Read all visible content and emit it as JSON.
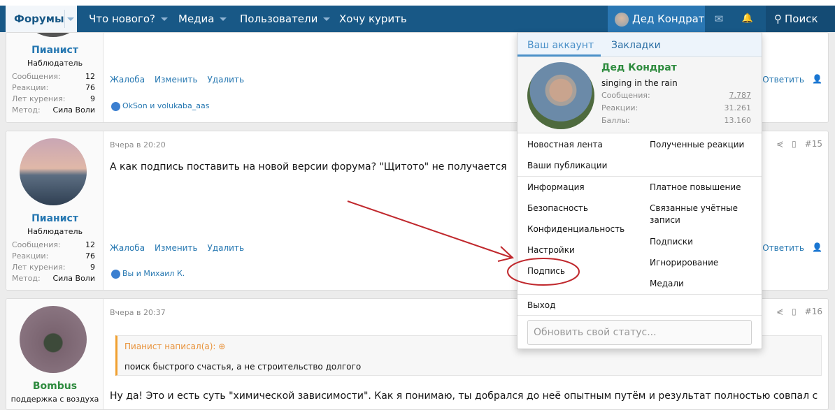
{
  "nav": {
    "items": [
      {
        "label": "Форумы"
      },
      {
        "label": "Что нового?"
      },
      {
        "label": "Медиа"
      },
      {
        "label": "Пользователи"
      },
      {
        "label": "Хочу курить"
      }
    ],
    "user": "Дед Кондрат",
    "search": "Поиск",
    "mail_icon": "✉",
    "bell_icon": "🔔",
    "search_icon": "⚲"
  },
  "posts": [
    {
      "author": "Пианист",
      "title": "Наблюдатель",
      "stats": [
        {
          "k": "Сообщения:",
          "v": "12"
        },
        {
          "k": "Реакции:",
          "v": "76"
        },
        {
          "k": "Лет курения:",
          "v": "9"
        },
        {
          "k": "Метод:",
          "v": "Сила Воли"
        }
      ],
      "actions": [
        "Жалоба",
        "Изменить",
        "Удалить"
      ],
      "likes": "OkSon и volukaba_aas",
      "reply": "Ответить"
    },
    {
      "author": "Пианист",
      "title": "Наблюдатель",
      "time": "Вчера в 20:20",
      "number": "#15",
      "message": "А как подпись поставить на новой версии форума? \"Щитото\" не получается",
      "stats": [
        {
          "k": "Сообщения:",
          "v": "12"
        },
        {
          "k": "Реакции:",
          "v": "76"
        },
        {
          "k": "Лет курения:",
          "v": "9"
        },
        {
          "k": "Метод:",
          "v": "Сила Воли"
        }
      ],
      "actions": [
        "Жалоба",
        "Изменить",
        "Удалить"
      ],
      "likes": "Вы и Михаил К.",
      "reply": "Ответить"
    },
    {
      "author": "Bombus",
      "title": "поддержка с воздуха",
      "time": "Вчера в 20:37",
      "number": "#16",
      "quote_author": "Пианист написал(а):",
      "quote_text": "поиск быстрого счастья, а не строительство долгого",
      "message": "Ну да! Это и есть суть \"химической зависимости\". Как я понимаю, ты добрался до неё опытным путём и результат полностью совпал с"
    }
  ],
  "dropdown": {
    "tabs": [
      "Ваш аккаунт",
      "Закладки"
    ],
    "name": "Дед Кондрат",
    "status": "singing in the rain",
    "stats": [
      {
        "k": "Сообщения:",
        "v": "7.787"
      },
      {
        "k": "Реакции:",
        "v": "31.261"
      },
      {
        "k": "Баллы:",
        "v": "13.160"
      }
    ],
    "menu1_left": [
      "Новостная лента",
      "Ваши публикации"
    ],
    "menu1_right": [
      "Полученные реакции"
    ],
    "menu2_left": [
      "Информация",
      "Безопасность",
      "Конфиденциальность",
      "Настройки",
      "Подпись"
    ],
    "menu2_right": [
      "Платное повышение",
      "Связанные учётные записи",
      "Подписки",
      "Игнорирование",
      "Медали"
    ],
    "logout": "Выход",
    "status_placeholder": "Обновить свой статус..."
  },
  "colors": {
    "nav": "#185886",
    "link": "#2577b1",
    "annotation": "#c0282d"
  }
}
